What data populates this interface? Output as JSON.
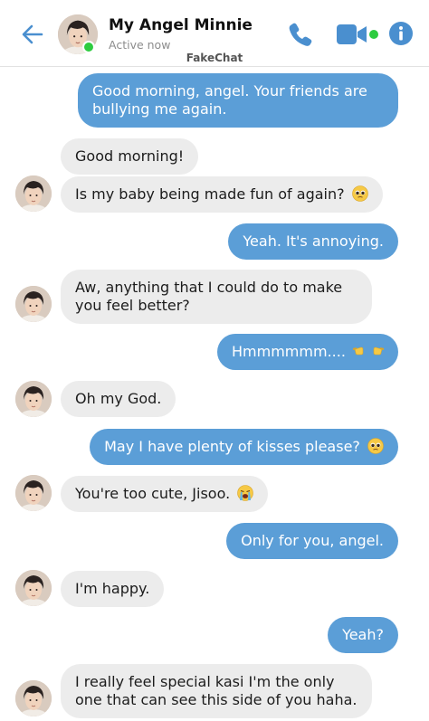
{
  "header": {
    "contact_name": "My Angel Minnie",
    "status": "Active now",
    "app_label": "FakeChat",
    "icons": {
      "back": "back-arrow-icon",
      "call": "phone-icon",
      "video": "video-camera-icon",
      "info": "info-icon"
    },
    "colors": {
      "accent": "#4a8fcf",
      "online": "#2ecc40"
    }
  },
  "messages": [
    {
      "sender": "me",
      "text": "Good morning, angel. Your friends are bullying me again."
    },
    {
      "sender": "them",
      "text": "Good morning!"
    },
    {
      "sender": "them",
      "text": "Is my baby being made fun of again?",
      "emoji": "pleading-face"
    },
    {
      "sender": "me",
      "text": "Yeah. It's annoying."
    },
    {
      "sender": "them",
      "text": "Aw, anything that I could do to make you feel better?"
    },
    {
      "sender": "me",
      "text": "Hmmmmmm....",
      "emoji": "pointing-fingers"
    },
    {
      "sender": "them",
      "text": "Oh my God."
    },
    {
      "sender": "me",
      "text": "May I have plenty of kisses please?",
      "emoji": "pleading-face"
    },
    {
      "sender": "them",
      "text": "You're too cute, Jisoo.",
      "emoji": "loudly-crying-face"
    },
    {
      "sender": "me",
      "text": "Only for you, angel."
    },
    {
      "sender": "them",
      "text": "I'm happy."
    },
    {
      "sender": "me",
      "text": "Yeah?"
    },
    {
      "sender": "them",
      "text": "I really feel special kasi I'm the only one that can see this side of you haha."
    }
  ],
  "colors": {
    "sent_bubble": "#5b9ed7",
    "received_bubble": "#ececec"
  }
}
